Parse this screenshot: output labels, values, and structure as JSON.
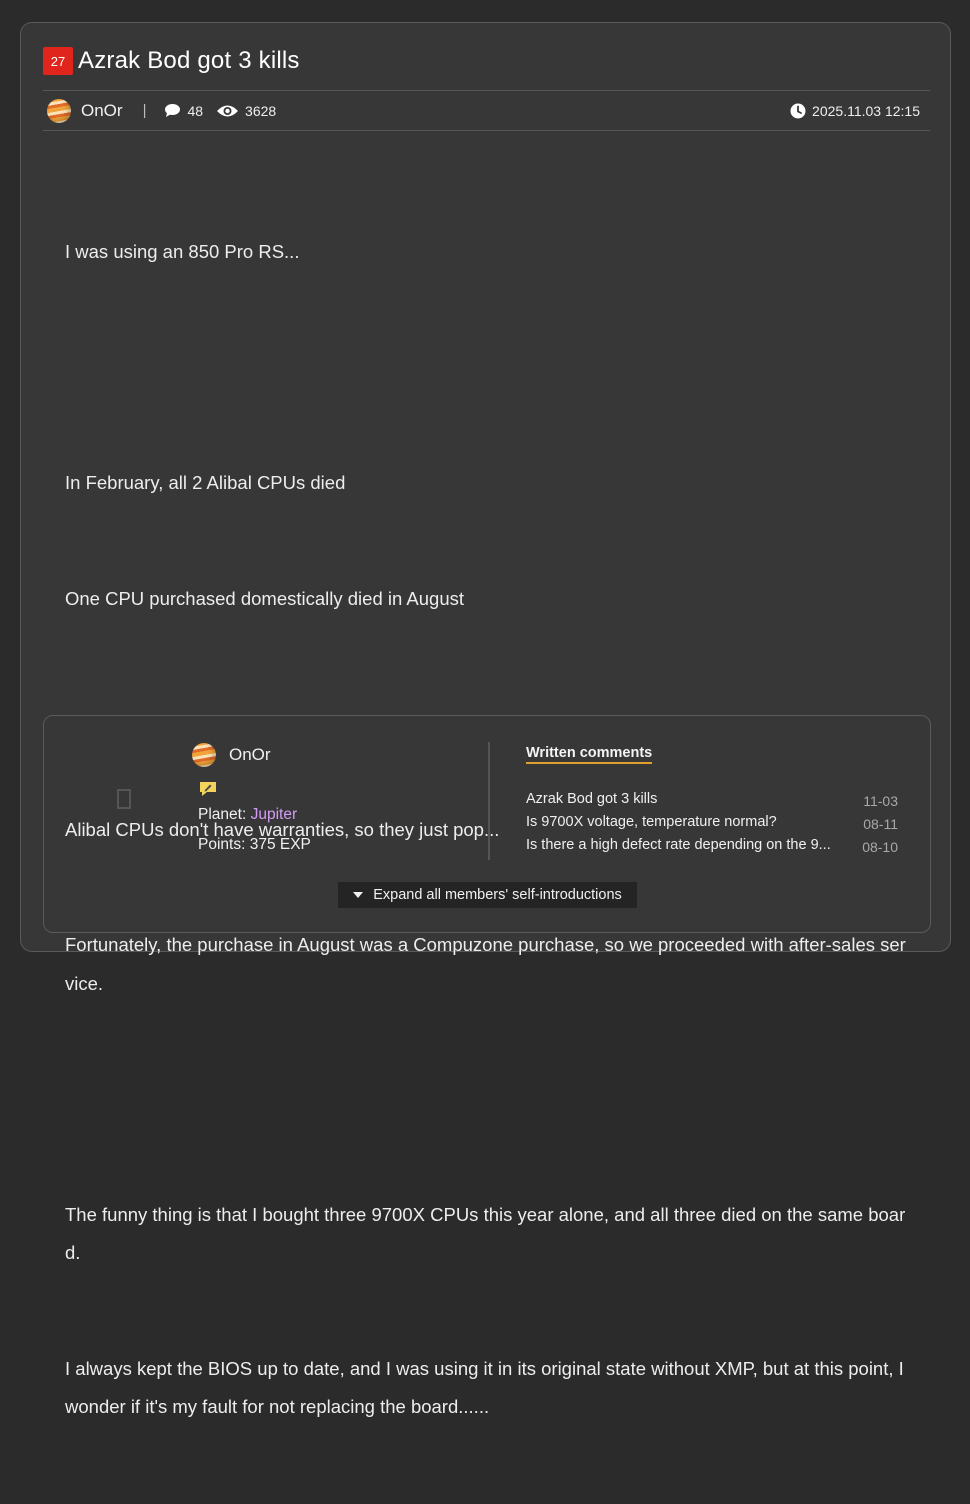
{
  "post": {
    "level_badge": "27",
    "title": "Azrak Bod got 3 kills",
    "author": "OnOr",
    "separator": "|",
    "comment_count": "48",
    "view_count": "3628",
    "datetime": "2025.11.03 12:15",
    "body_paragraphs": [
      "I was using an 850 Pro RS...",
      "",
      "In February, all 2 Alibal CPUs died",
      "One CPU purchased domestically died in August",
      "",
      "Alibal CPUs don't have warranties, so they just pop...",
      "Fortunately, the purchase in August was a Compuzone purchase, so we proceeded with after-sales service.",
      "",
      "The funny thing is that I bought three 9700X CPUs this year alone, and all three died on the same board.",
      "I always kept the BIOS up to date, and I was using it in its original state without XMP, but at this point, I wonder if it's my fault for not replacing the board......"
    ]
  },
  "profile": {
    "name": "OnOr",
    "planet_label": "Planet:",
    "planet_value": "Jupiter",
    "points_label": "Points:",
    "points_value": "375 EXP",
    "comments_heading": "Written comments",
    "comments": [
      {
        "title": "Azrak Bod got 3 kills",
        "date": "11-03"
      },
      {
        "title": "Is 9700X voltage, temperature normal?",
        "date": "08-11"
      },
      {
        "title": "Is there a high defect rate depending on the 9...",
        "date": "08-10"
      }
    ],
    "expand_label": "Expand all members' self-introductions"
  },
  "icons": {
    "comment": "speech-bubble-icon",
    "views": "eye-icon",
    "time": "clock-icon",
    "memo": "memo-icon"
  },
  "colors": {
    "badge": "#e0261c",
    "planet": "#d49cf5",
    "heading_underline": "#e0a030"
  }
}
